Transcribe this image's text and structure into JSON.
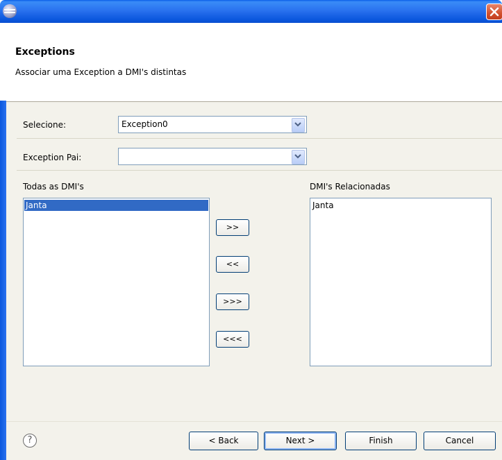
{
  "titlebar": {
    "app_icon": "eclipse-icon",
    "close_icon": "close-icon"
  },
  "header": {
    "title": "Exceptions",
    "subtitle": "Associar uma Exception a DMI's distintas"
  },
  "form": {
    "selecione_label": "Selecione:",
    "selecione_value": "Exception0",
    "pai_label": "Exception Pai:",
    "pai_value": ""
  },
  "lists": {
    "left_title": "Todas as DMI's",
    "left_items": [
      "Janta"
    ],
    "right_title": "DMI's Relacionadas",
    "right_items": [
      "Janta"
    ]
  },
  "move_buttons": {
    "add": ">>",
    "remove": "<<",
    "add_all": ">>>",
    "remove_all": "<<<"
  },
  "footer": {
    "help_icon": "help-icon",
    "help_glyph": "?",
    "back": "< Back",
    "next": "Next >",
    "finish": "Finish",
    "cancel": "Cancel"
  },
  "colors": {
    "titlebar": "#0b57dd",
    "selection": "#316ac5",
    "panel": "#f3f2eb",
    "close": "#d2512f"
  }
}
